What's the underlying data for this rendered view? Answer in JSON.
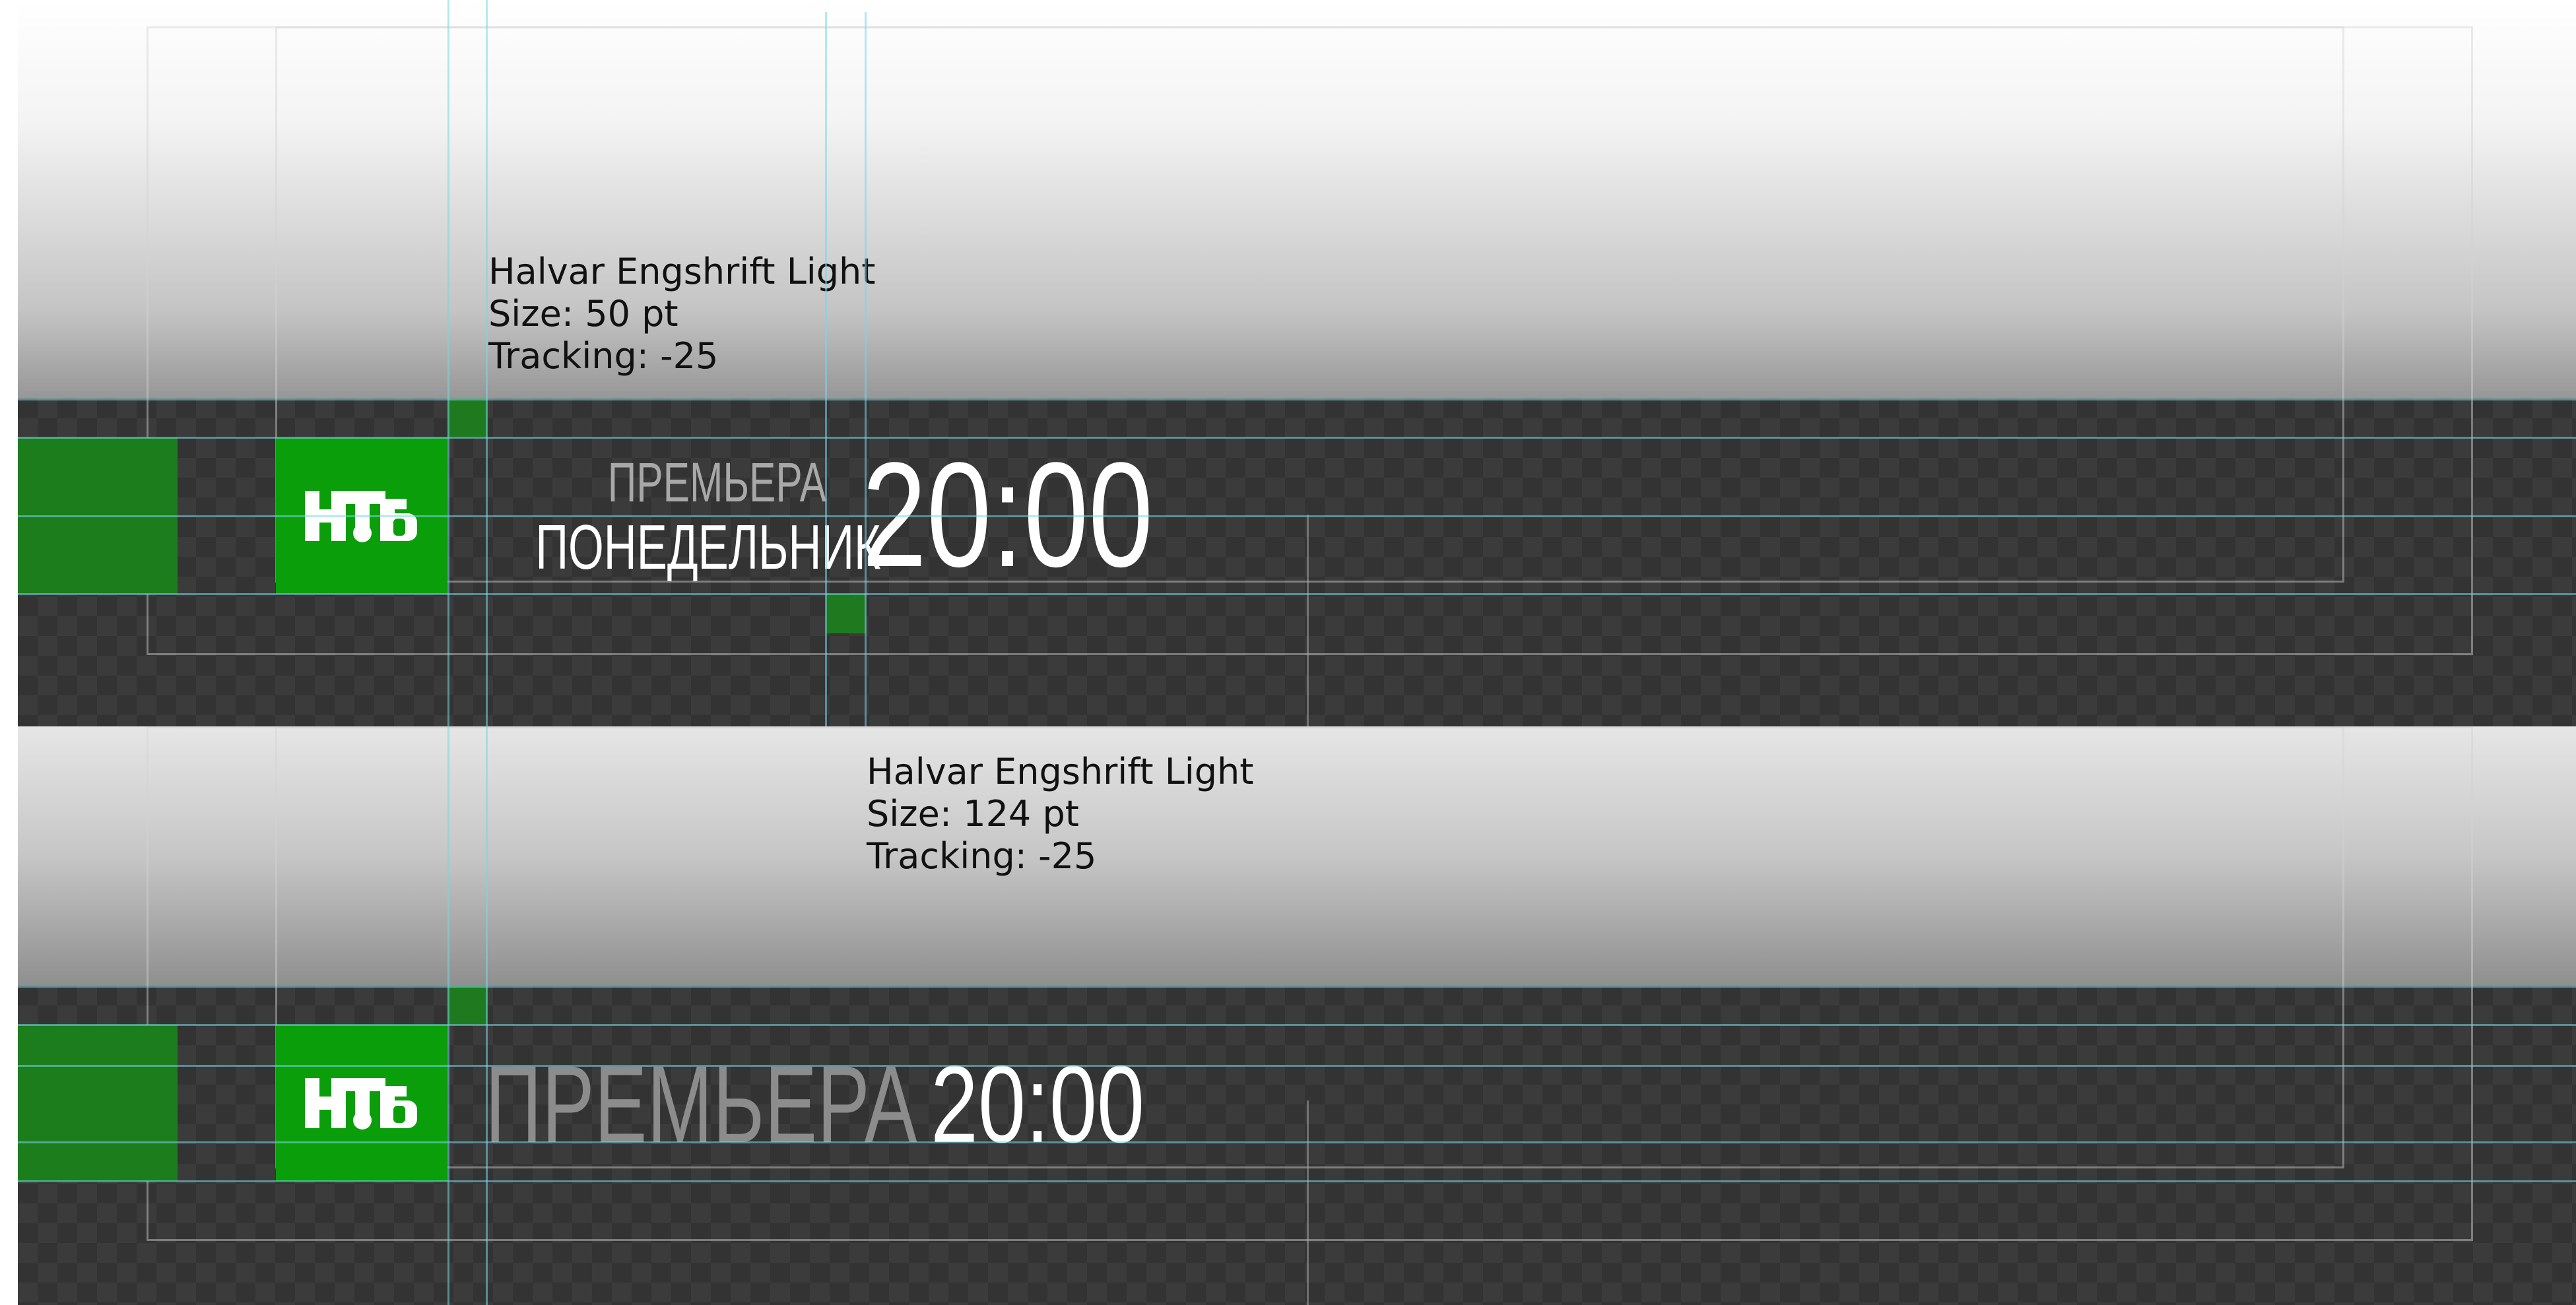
{
  "annotation_top": {
    "font_line": "Halvar Engshrift Light",
    "size_line": "Size: 50 pt",
    "tracking_line": "Tracking: -25"
  },
  "annotation_mid": {
    "font_line": "Halvar Engshrift Light",
    "size_line": "Size: 124 pt",
    "tracking_line": "Tracking: -25"
  },
  "banner_1": {
    "logo": "НТВ",
    "line1": "ПРЕМЬЕРА",
    "line2": "ПОНЕДЕЛЬНИК",
    "time": "20:00"
  },
  "banner_2": {
    "logo": "НТВ",
    "label": "ПРЕМЬЕРА",
    "time": "20:00"
  },
  "colors": {
    "brand_green": "#0a9e0a",
    "band_dark": "#333333",
    "label_gray": "#a8a8a8",
    "text_white": "#ffffff"
  }
}
